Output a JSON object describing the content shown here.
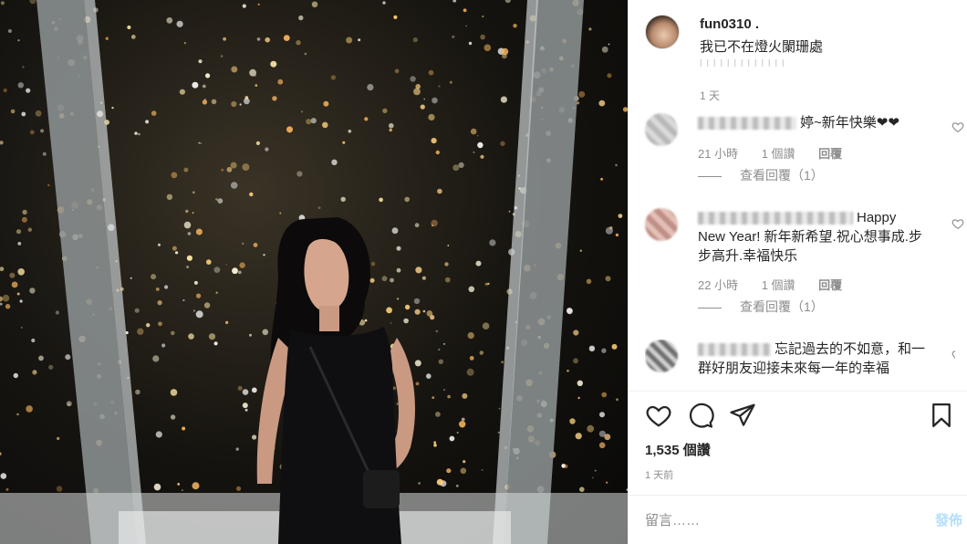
{
  "post": {
    "username": "fun0310 .",
    "caption": "我已不在燈火闌珊處",
    "caption_sub": "l l l l l l l l l l l l l",
    "caption_time": "1 天"
  },
  "comments": [
    {
      "text": "婷~新年快樂❤❤",
      "time": "21 小時",
      "likes": "1 個讚",
      "reply": "回覆",
      "view_replies": "查看回覆（1）"
    },
    {
      "text": "Happy New Year! 新年新希望.祝心想事成.步步高升.幸福快乐",
      "time": "22 小時",
      "likes": "1 個讚",
      "reply": "回覆",
      "view_replies": "查看回覆（1）"
    },
    {
      "text": "忘記過去的不如意，和一群好朋友迎接未來每一年的幸福"
    }
  ],
  "actions": {
    "like_icon": "heart-icon",
    "comment_icon": "comment-icon",
    "share_icon": "share-icon",
    "save_icon": "bookmark-icon"
  },
  "likes_count": "1,535 個讚",
  "post_time": "1 天前",
  "comment_box": {
    "placeholder": "留言……",
    "post_label": "發佈"
  },
  "colors": {
    "text": "#262626",
    "muted": "#8e8e8e",
    "post_button": "#b2dffc",
    "divider": "#efefef"
  }
}
